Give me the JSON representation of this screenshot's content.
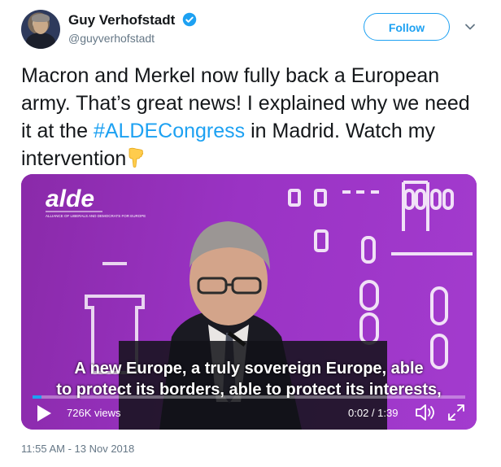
{
  "user": {
    "name": "Guy Verhofstadt",
    "handle": "@guyverhofstadt",
    "verified": true
  },
  "follow_button": {
    "label": "Follow"
  },
  "tweet": {
    "text_before": "Macron and Merkel now fully back a European army. That’s great news! I explained why we need it at the ",
    "hashtag": "#ALDECongress",
    "text_after": " in Madrid. Watch my intervention",
    "emoji": "pointing-down-emoji"
  },
  "video": {
    "logo_text": "alde",
    "logo_subtext": "ALLIANCE OF LIBERALS AND DEMOCRATS FOR EUROPE",
    "caption_line1": "A new Europe, a truly sovereign Europe, able",
    "caption_line2": "to protect its borders, able to protect its interests,",
    "views": "726K views",
    "time": "0:02 / 1:39",
    "progress_fraction": 0.02,
    "accent_color": "#1da1f2",
    "background_color": "#9a33c4"
  },
  "timestamp": "11:55 AM - 13 Nov 2018",
  "colors": {
    "link": "#1da1f2",
    "text": "#14171a",
    "secondary": "#657786"
  }
}
